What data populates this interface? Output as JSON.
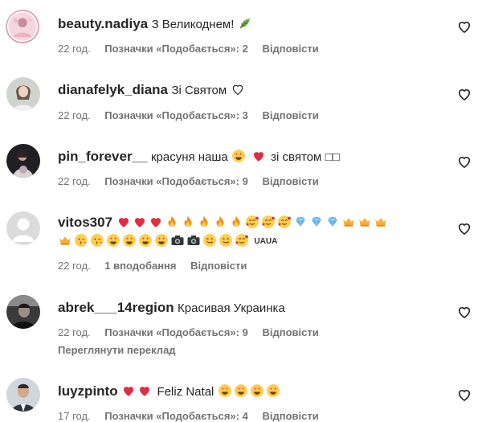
{
  "comments": [
    {
      "username": "beauty.nadiya",
      "text": "З Великоднем!",
      "emoji": [
        "leaf"
      ],
      "time": "22 год.",
      "likes": "Позначки «Подобається»: 2",
      "reply": "Відповісти"
    },
    {
      "username": "dianafelyk_diana",
      "text": "Зі Святом",
      "emoji": [
        "outline-heart"
      ],
      "time": "22 год.",
      "likes": "Позначки «Подобається»: 3",
      "reply": "Відповісти"
    },
    {
      "username": "pin_forever__",
      "text": "красуня наша",
      "text2": "зі святом",
      "emoji": [
        "heart-eyes",
        "red-heart"
      ],
      "tail": "□□",
      "time": "22 год.",
      "likes": "Позначки «Подобається»: 9",
      "reply": "Відповісти"
    },
    {
      "username": "vitos307",
      "emoji_line1": [
        "red-heart",
        "red-heart",
        "red-heart",
        "fire",
        "fire",
        "fire",
        "fire",
        "fire",
        "smiling-hearts",
        "smiling-hearts",
        "smiling-hearts",
        "gem",
        "gem",
        "gem",
        "crown",
        "crown",
        "crown"
      ],
      "emoji_line2": [
        "crown",
        "kiss-wink",
        "kiss-wink",
        "heart-eyes",
        "heart-eyes",
        "heart-eyes",
        "heart-eyes",
        "camera",
        "camera",
        "yum",
        "yum",
        "smiling-hearts"
      ],
      "tail": "UAUA",
      "time": "22 год.",
      "likes": "1 вподобання",
      "reply": "Відповісти"
    },
    {
      "username": "abrek___14region",
      "text": "Красивая Украинка",
      "time": "22 год.",
      "likes": "Позначки «Подобається»: 9",
      "reply": "Відповісти",
      "translate": "Переглянути переклад"
    },
    {
      "username": "luyzpinto",
      "text": "Feliz Natal",
      "emoji_pre": [
        "red-heart",
        "red-heart"
      ],
      "emoji_post": [
        "heart-eyes",
        "heart-eyes",
        "heart-eyes",
        "heart-eyes"
      ],
      "time": "17 год.",
      "likes": "Позначки «Подобається»: 4",
      "reply": "Відповісти"
    }
  ],
  "colors": {
    "text": "#262626",
    "meta": "#737373",
    "heart": "#e0245e"
  }
}
